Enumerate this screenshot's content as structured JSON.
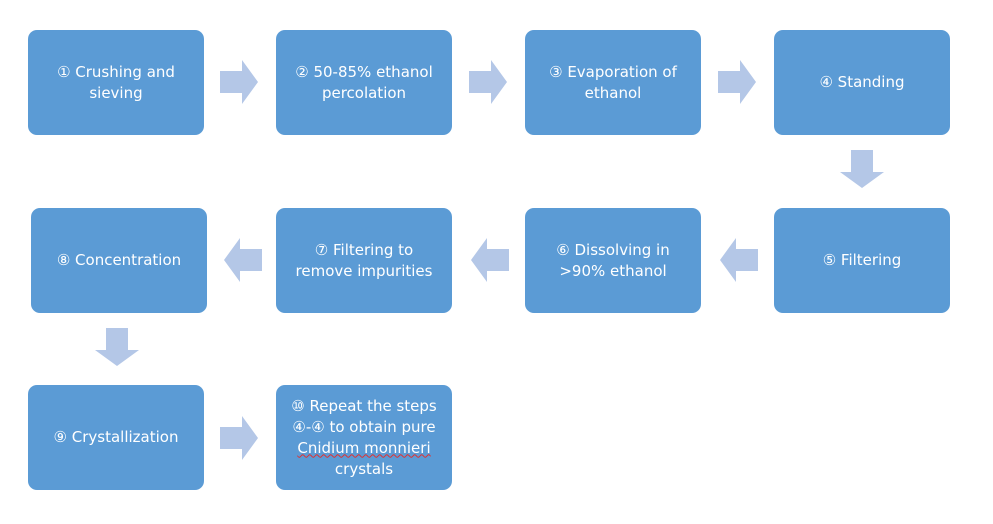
{
  "colors": {
    "box": "#5b9bd5",
    "arrow": "#b4c7e7",
    "text": "#ffffff"
  },
  "steps": [
    {
      "label": "① Crushing and sieving"
    },
    {
      "label": "② 50-85% ethanol percolation"
    },
    {
      "label": "③ Evaporation of ethanol"
    },
    {
      "label": "④ Standing"
    },
    {
      "label": "⑤ Filtering"
    },
    {
      "label": "⑥ Dissolving in >90% ethanol"
    },
    {
      "label": "⑦ Filtering to remove impurities"
    },
    {
      "label": "⑧ Concentration"
    },
    {
      "label": "⑨ Crystallization"
    },
    {
      "label_pre": "⑩ Repeat the steps ④-④ to obtain pure",
      "label_species": "Cnidium monnieri",
      "label_post": "crystals"
    }
  ]
}
